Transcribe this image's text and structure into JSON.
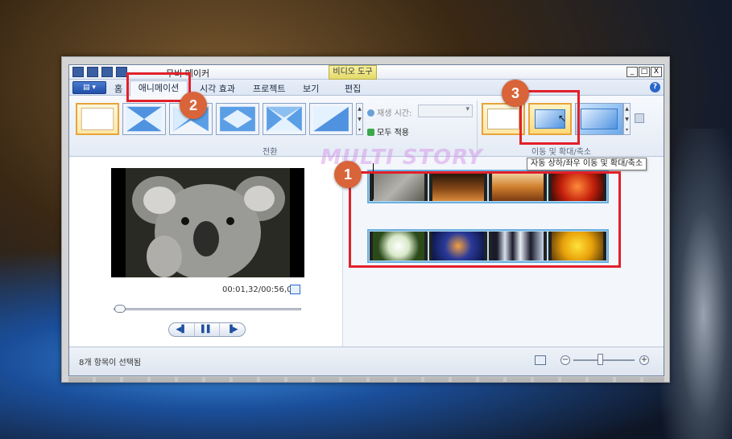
{
  "window": {
    "title": "무비 메이커",
    "context_tab": "비디오 도구",
    "controls": [
      "_",
      "□",
      "X"
    ]
  },
  "ribbon_tabs": {
    "app_button": "▤ ▾",
    "items": [
      "홈",
      "애니메이션",
      "시각 효과",
      "프로젝트",
      "보기",
      "편집"
    ],
    "active": "애니메이션"
  },
  "transitions": {
    "group_label": "전환",
    "duration_label": "재생 시간:",
    "apply_all_label": "모두 적용"
  },
  "pan_zoom": {
    "group_label": "이동 및 확대/축소",
    "tooltip": "자동 상하/좌우 이동 및 확대/축소"
  },
  "preview": {
    "time": "00:01,32/00:56,00"
  },
  "playback": {
    "prev": "◀▌",
    "play": "▌▌",
    "next": "▐▶"
  },
  "storyboard": {
    "watermark": "MULTI STORY",
    "row1": [
      "koala",
      "desert",
      "canyon",
      "flower"
    ],
    "row2": [
      "hydrangea",
      "jellyfish",
      "penguins",
      "tulips"
    ]
  },
  "status": {
    "text": "8개 항목이 선택됨",
    "zoom_minus": "−",
    "zoom_plus": "+"
  },
  "annotations": {
    "badges": [
      "1",
      "2",
      "3"
    ]
  },
  "colors": {
    "annotation_red": "#e2202a",
    "badge_orange": "#d9643a",
    "selection_gold": "#e7a43a",
    "clip_border": "#6ab0e0"
  }
}
